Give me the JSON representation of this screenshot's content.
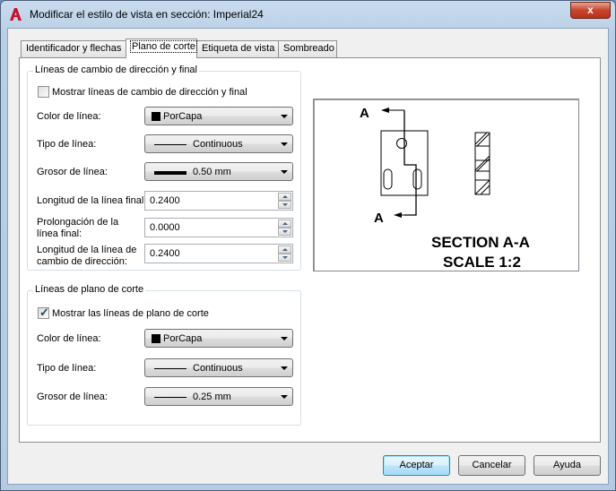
{
  "window": {
    "title": "Modificar el estilo de vista en sección: Imperial24",
    "close_glyph": "x"
  },
  "tabs": [
    {
      "label": "Identificador y flechas"
    },
    {
      "label": "Plano de corte"
    },
    {
      "label": "Etiqueta de vista"
    },
    {
      "label": "Sombreado"
    }
  ],
  "group1": {
    "title": "Líneas de cambio de dirección y final",
    "checkbox_label": "Mostrar líneas de cambio de dirección y final",
    "checkbox_checked": false,
    "color_label": "Color de línea:",
    "color_value": "PorCapa",
    "linetype_label": "Tipo de línea:",
    "linetype_value": "Continuous",
    "weight_label": "Grosor de línea:",
    "weight_value": "0.50 mm",
    "end_length_label": "Longitud de la línea final:",
    "end_length_value": "0.2400",
    "end_ext_label": "Prolongación de la línea final:",
    "end_ext_value": "0.0000",
    "bend_length_label": "Longitud de la línea de cambio de dirección:",
    "bend_length_value": "0.2400"
  },
  "group2": {
    "title": "Líneas de plano de corte",
    "checkbox_label": "Mostrar las líneas de plano de corte",
    "checkbox_checked": true,
    "color_label": "Color de línea:",
    "color_value": "PorCapa",
    "linetype_label": "Tipo de línea:",
    "linetype_value": "Continuous",
    "weight_label": "Grosor de línea:",
    "weight_value": "0.25 mm"
  },
  "preview": {
    "label_a_top": "A",
    "label_a_bottom": "A",
    "section_text": "SECTION A-A",
    "scale_text": "SCALE 1:2"
  },
  "buttons": {
    "ok": "Aceptar",
    "cancel": "Cancelar",
    "help": "Ayuda"
  }
}
